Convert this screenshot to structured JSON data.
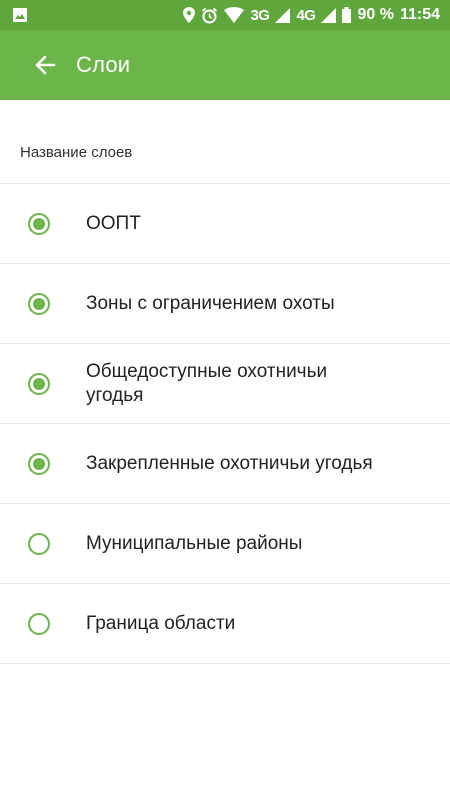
{
  "status_bar": {
    "net_3g": "3G",
    "net_4g": "4G",
    "battery": "90 %",
    "time": "11:54",
    "icons": [
      "image-icon",
      "location-icon",
      "alarm-icon",
      "wifi-icon",
      "signal-icon",
      "signal-icon",
      "battery-icon"
    ]
  },
  "app_bar": {
    "back_icon": "arrow-left-icon",
    "title": "Слои"
  },
  "section": {
    "header": "Название слоев"
  },
  "layers": [
    {
      "label": "ООПТ",
      "checked": true
    },
    {
      "label": "Зоны с ограничением охоты",
      "checked": true
    },
    {
      "label": "Общедоступные охотничьи угодья",
      "checked": true
    },
    {
      "label": "Закрепленные охотничьи угодья",
      "checked": true
    },
    {
      "label": "Муниципальные районы",
      "checked": false
    },
    {
      "label": "Граница области",
      "checked": false
    }
  ],
  "colors": {
    "status_bar": "#5fa63d",
    "app_bar": "#6cb54a",
    "accent": "#6cb54a"
  }
}
